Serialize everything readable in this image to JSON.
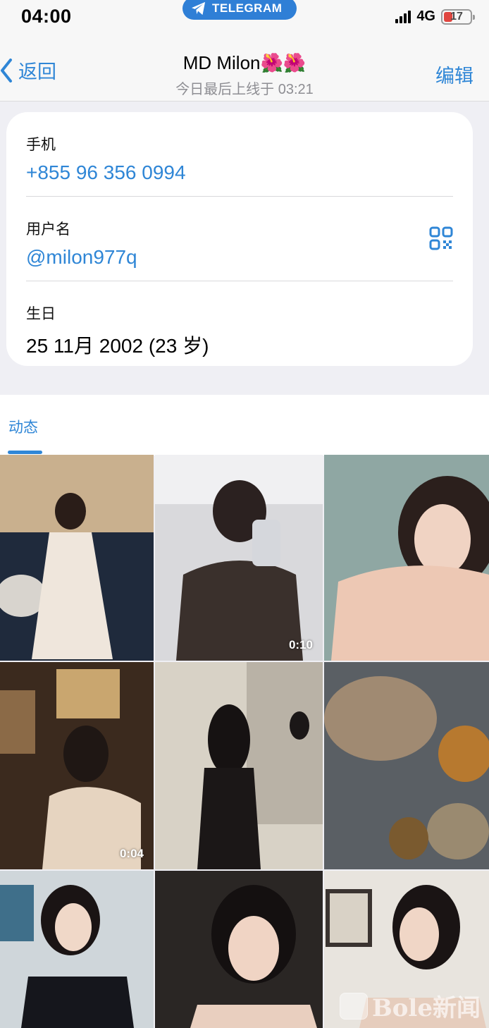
{
  "status_bar": {
    "time": "04:00",
    "app_pill": "TELEGRAM",
    "network": "4G",
    "battery": "17",
    "battery_level": 0.17
  },
  "nav": {
    "back_label": "返回",
    "title": "MD Milon🌺🌺",
    "subtitle": "今日最后上线于 03:21",
    "edit_label": "编辑"
  },
  "info": {
    "phone_label": "手机",
    "phone_value": "+855 96 356 0994",
    "username_label": "用户名",
    "username_value": "@milon977q",
    "birthday_label": "生日",
    "birthday_value": "25 11月 2002 (23 岁)"
  },
  "tabs": [
    {
      "label": "动态",
      "active": true
    }
  ],
  "media": [
    {
      "type": "photo",
      "duration": ""
    },
    {
      "type": "video",
      "duration": "0:10"
    },
    {
      "type": "photo",
      "duration": ""
    },
    {
      "type": "video",
      "duration": "0:04"
    },
    {
      "type": "photo",
      "duration": ""
    },
    {
      "type": "photo",
      "duration": ""
    },
    {
      "type": "photo",
      "duration": ""
    },
    {
      "type": "photo",
      "duration": ""
    },
    {
      "type": "photo",
      "duration": ""
    }
  ],
  "watermark": "Bole新闻",
  "colors": {
    "accent": "#2f86d6",
    "telegram_pill": "#2f7fd6",
    "battery_low": "#e0463f"
  }
}
